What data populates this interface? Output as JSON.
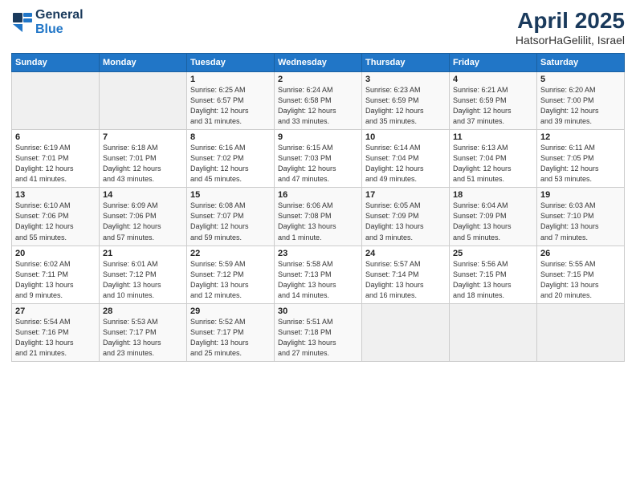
{
  "header": {
    "logo_line1": "General",
    "logo_line2": "Blue",
    "month": "April 2025",
    "location": "HatsorHaGelilit, Israel"
  },
  "weekdays": [
    "Sunday",
    "Monday",
    "Tuesday",
    "Wednesday",
    "Thursday",
    "Friday",
    "Saturday"
  ],
  "weeks": [
    [
      {
        "day": "",
        "info": ""
      },
      {
        "day": "",
        "info": ""
      },
      {
        "day": "1",
        "info": "Sunrise: 6:25 AM\nSunset: 6:57 PM\nDaylight: 12 hours\nand 31 minutes."
      },
      {
        "day": "2",
        "info": "Sunrise: 6:24 AM\nSunset: 6:58 PM\nDaylight: 12 hours\nand 33 minutes."
      },
      {
        "day": "3",
        "info": "Sunrise: 6:23 AM\nSunset: 6:59 PM\nDaylight: 12 hours\nand 35 minutes."
      },
      {
        "day": "4",
        "info": "Sunrise: 6:21 AM\nSunset: 6:59 PM\nDaylight: 12 hours\nand 37 minutes."
      },
      {
        "day": "5",
        "info": "Sunrise: 6:20 AM\nSunset: 7:00 PM\nDaylight: 12 hours\nand 39 minutes."
      }
    ],
    [
      {
        "day": "6",
        "info": "Sunrise: 6:19 AM\nSunset: 7:01 PM\nDaylight: 12 hours\nand 41 minutes."
      },
      {
        "day": "7",
        "info": "Sunrise: 6:18 AM\nSunset: 7:01 PM\nDaylight: 12 hours\nand 43 minutes."
      },
      {
        "day": "8",
        "info": "Sunrise: 6:16 AM\nSunset: 7:02 PM\nDaylight: 12 hours\nand 45 minutes."
      },
      {
        "day": "9",
        "info": "Sunrise: 6:15 AM\nSunset: 7:03 PM\nDaylight: 12 hours\nand 47 minutes."
      },
      {
        "day": "10",
        "info": "Sunrise: 6:14 AM\nSunset: 7:04 PM\nDaylight: 12 hours\nand 49 minutes."
      },
      {
        "day": "11",
        "info": "Sunrise: 6:13 AM\nSunset: 7:04 PM\nDaylight: 12 hours\nand 51 minutes."
      },
      {
        "day": "12",
        "info": "Sunrise: 6:11 AM\nSunset: 7:05 PM\nDaylight: 12 hours\nand 53 minutes."
      }
    ],
    [
      {
        "day": "13",
        "info": "Sunrise: 6:10 AM\nSunset: 7:06 PM\nDaylight: 12 hours\nand 55 minutes."
      },
      {
        "day": "14",
        "info": "Sunrise: 6:09 AM\nSunset: 7:06 PM\nDaylight: 12 hours\nand 57 minutes."
      },
      {
        "day": "15",
        "info": "Sunrise: 6:08 AM\nSunset: 7:07 PM\nDaylight: 12 hours\nand 59 minutes."
      },
      {
        "day": "16",
        "info": "Sunrise: 6:06 AM\nSunset: 7:08 PM\nDaylight: 13 hours\nand 1 minute."
      },
      {
        "day": "17",
        "info": "Sunrise: 6:05 AM\nSunset: 7:09 PM\nDaylight: 13 hours\nand 3 minutes."
      },
      {
        "day": "18",
        "info": "Sunrise: 6:04 AM\nSunset: 7:09 PM\nDaylight: 13 hours\nand 5 minutes."
      },
      {
        "day": "19",
        "info": "Sunrise: 6:03 AM\nSunset: 7:10 PM\nDaylight: 13 hours\nand 7 minutes."
      }
    ],
    [
      {
        "day": "20",
        "info": "Sunrise: 6:02 AM\nSunset: 7:11 PM\nDaylight: 13 hours\nand 9 minutes."
      },
      {
        "day": "21",
        "info": "Sunrise: 6:01 AM\nSunset: 7:12 PM\nDaylight: 13 hours\nand 10 minutes."
      },
      {
        "day": "22",
        "info": "Sunrise: 5:59 AM\nSunset: 7:12 PM\nDaylight: 13 hours\nand 12 minutes."
      },
      {
        "day": "23",
        "info": "Sunrise: 5:58 AM\nSunset: 7:13 PM\nDaylight: 13 hours\nand 14 minutes."
      },
      {
        "day": "24",
        "info": "Sunrise: 5:57 AM\nSunset: 7:14 PM\nDaylight: 13 hours\nand 16 minutes."
      },
      {
        "day": "25",
        "info": "Sunrise: 5:56 AM\nSunset: 7:15 PM\nDaylight: 13 hours\nand 18 minutes."
      },
      {
        "day": "26",
        "info": "Sunrise: 5:55 AM\nSunset: 7:15 PM\nDaylight: 13 hours\nand 20 minutes."
      }
    ],
    [
      {
        "day": "27",
        "info": "Sunrise: 5:54 AM\nSunset: 7:16 PM\nDaylight: 13 hours\nand 21 minutes."
      },
      {
        "day": "28",
        "info": "Sunrise: 5:53 AM\nSunset: 7:17 PM\nDaylight: 13 hours\nand 23 minutes."
      },
      {
        "day": "29",
        "info": "Sunrise: 5:52 AM\nSunset: 7:17 PM\nDaylight: 13 hours\nand 25 minutes."
      },
      {
        "day": "30",
        "info": "Sunrise: 5:51 AM\nSunset: 7:18 PM\nDaylight: 13 hours\nand 27 minutes."
      },
      {
        "day": "",
        "info": ""
      },
      {
        "day": "",
        "info": ""
      },
      {
        "day": "",
        "info": ""
      }
    ]
  ]
}
